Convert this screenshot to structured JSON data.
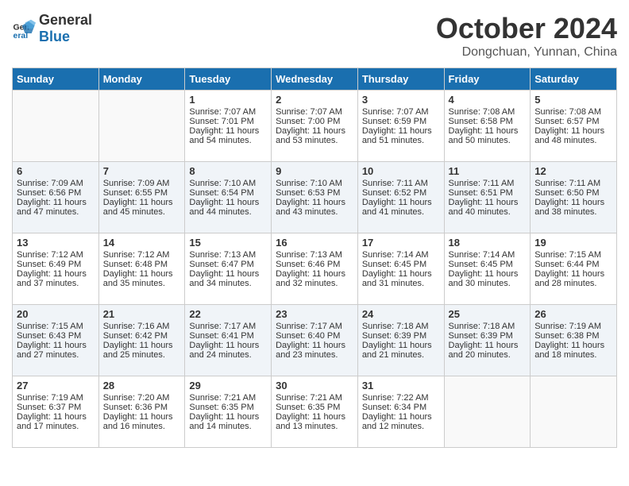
{
  "header": {
    "logo_general": "General",
    "logo_blue": "Blue",
    "month": "October 2024",
    "location": "Dongchuan, Yunnan, China"
  },
  "weekdays": [
    "Sunday",
    "Monday",
    "Tuesday",
    "Wednesday",
    "Thursday",
    "Friday",
    "Saturday"
  ],
  "weeks": [
    [
      {
        "day": "",
        "sunrise": "",
        "sunset": "",
        "daylight": ""
      },
      {
        "day": "",
        "sunrise": "",
        "sunset": "",
        "daylight": ""
      },
      {
        "day": "1",
        "sunrise": "Sunrise: 7:07 AM",
        "sunset": "Sunset: 7:01 PM",
        "daylight": "Daylight: 11 hours and 54 minutes."
      },
      {
        "day": "2",
        "sunrise": "Sunrise: 7:07 AM",
        "sunset": "Sunset: 7:00 PM",
        "daylight": "Daylight: 11 hours and 53 minutes."
      },
      {
        "day": "3",
        "sunrise": "Sunrise: 7:07 AM",
        "sunset": "Sunset: 6:59 PM",
        "daylight": "Daylight: 11 hours and 51 minutes."
      },
      {
        "day": "4",
        "sunrise": "Sunrise: 7:08 AM",
        "sunset": "Sunset: 6:58 PM",
        "daylight": "Daylight: 11 hours and 50 minutes."
      },
      {
        "day": "5",
        "sunrise": "Sunrise: 7:08 AM",
        "sunset": "Sunset: 6:57 PM",
        "daylight": "Daylight: 11 hours and 48 minutes."
      }
    ],
    [
      {
        "day": "6",
        "sunrise": "Sunrise: 7:09 AM",
        "sunset": "Sunset: 6:56 PM",
        "daylight": "Daylight: 11 hours and 47 minutes."
      },
      {
        "day": "7",
        "sunrise": "Sunrise: 7:09 AM",
        "sunset": "Sunset: 6:55 PM",
        "daylight": "Daylight: 11 hours and 45 minutes."
      },
      {
        "day": "8",
        "sunrise": "Sunrise: 7:10 AM",
        "sunset": "Sunset: 6:54 PM",
        "daylight": "Daylight: 11 hours and 44 minutes."
      },
      {
        "day": "9",
        "sunrise": "Sunrise: 7:10 AM",
        "sunset": "Sunset: 6:53 PM",
        "daylight": "Daylight: 11 hours and 43 minutes."
      },
      {
        "day": "10",
        "sunrise": "Sunrise: 7:11 AM",
        "sunset": "Sunset: 6:52 PM",
        "daylight": "Daylight: 11 hours and 41 minutes."
      },
      {
        "day": "11",
        "sunrise": "Sunrise: 7:11 AM",
        "sunset": "Sunset: 6:51 PM",
        "daylight": "Daylight: 11 hours and 40 minutes."
      },
      {
        "day": "12",
        "sunrise": "Sunrise: 7:11 AM",
        "sunset": "Sunset: 6:50 PM",
        "daylight": "Daylight: 11 hours and 38 minutes."
      }
    ],
    [
      {
        "day": "13",
        "sunrise": "Sunrise: 7:12 AM",
        "sunset": "Sunset: 6:49 PM",
        "daylight": "Daylight: 11 hours and 37 minutes."
      },
      {
        "day": "14",
        "sunrise": "Sunrise: 7:12 AM",
        "sunset": "Sunset: 6:48 PM",
        "daylight": "Daylight: 11 hours and 35 minutes."
      },
      {
        "day": "15",
        "sunrise": "Sunrise: 7:13 AM",
        "sunset": "Sunset: 6:47 PM",
        "daylight": "Daylight: 11 hours and 34 minutes."
      },
      {
        "day": "16",
        "sunrise": "Sunrise: 7:13 AM",
        "sunset": "Sunset: 6:46 PM",
        "daylight": "Daylight: 11 hours and 32 minutes."
      },
      {
        "day": "17",
        "sunrise": "Sunrise: 7:14 AM",
        "sunset": "Sunset: 6:45 PM",
        "daylight": "Daylight: 11 hours and 31 minutes."
      },
      {
        "day": "18",
        "sunrise": "Sunrise: 7:14 AM",
        "sunset": "Sunset: 6:45 PM",
        "daylight": "Daylight: 11 hours and 30 minutes."
      },
      {
        "day": "19",
        "sunrise": "Sunrise: 7:15 AM",
        "sunset": "Sunset: 6:44 PM",
        "daylight": "Daylight: 11 hours and 28 minutes."
      }
    ],
    [
      {
        "day": "20",
        "sunrise": "Sunrise: 7:15 AM",
        "sunset": "Sunset: 6:43 PM",
        "daylight": "Daylight: 11 hours and 27 minutes."
      },
      {
        "day": "21",
        "sunrise": "Sunrise: 7:16 AM",
        "sunset": "Sunset: 6:42 PM",
        "daylight": "Daylight: 11 hours and 25 minutes."
      },
      {
        "day": "22",
        "sunrise": "Sunrise: 7:17 AM",
        "sunset": "Sunset: 6:41 PM",
        "daylight": "Daylight: 11 hours and 24 minutes."
      },
      {
        "day": "23",
        "sunrise": "Sunrise: 7:17 AM",
        "sunset": "Sunset: 6:40 PM",
        "daylight": "Daylight: 11 hours and 23 minutes."
      },
      {
        "day": "24",
        "sunrise": "Sunrise: 7:18 AM",
        "sunset": "Sunset: 6:39 PM",
        "daylight": "Daylight: 11 hours and 21 minutes."
      },
      {
        "day": "25",
        "sunrise": "Sunrise: 7:18 AM",
        "sunset": "Sunset: 6:39 PM",
        "daylight": "Daylight: 11 hours and 20 minutes."
      },
      {
        "day": "26",
        "sunrise": "Sunrise: 7:19 AM",
        "sunset": "Sunset: 6:38 PM",
        "daylight": "Daylight: 11 hours and 18 minutes."
      }
    ],
    [
      {
        "day": "27",
        "sunrise": "Sunrise: 7:19 AM",
        "sunset": "Sunset: 6:37 PM",
        "daylight": "Daylight: 11 hours and 17 minutes."
      },
      {
        "day": "28",
        "sunrise": "Sunrise: 7:20 AM",
        "sunset": "Sunset: 6:36 PM",
        "daylight": "Daylight: 11 hours and 16 minutes."
      },
      {
        "day": "29",
        "sunrise": "Sunrise: 7:21 AM",
        "sunset": "Sunset: 6:35 PM",
        "daylight": "Daylight: 11 hours and 14 minutes."
      },
      {
        "day": "30",
        "sunrise": "Sunrise: 7:21 AM",
        "sunset": "Sunset: 6:35 PM",
        "daylight": "Daylight: 11 hours and 13 minutes."
      },
      {
        "day": "31",
        "sunrise": "Sunrise: 7:22 AM",
        "sunset": "Sunset: 6:34 PM",
        "daylight": "Daylight: 11 hours and 12 minutes."
      },
      {
        "day": "",
        "sunrise": "",
        "sunset": "",
        "daylight": ""
      },
      {
        "day": "",
        "sunrise": "",
        "sunset": "",
        "daylight": ""
      }
    ]
  ]
}
